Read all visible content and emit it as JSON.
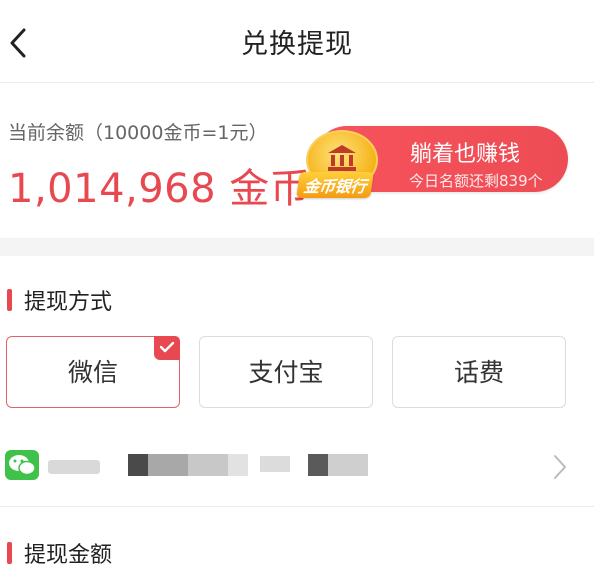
{
  "nav": {
    "title": "兑换提现"
  },
  "balance": {
    "label": "当前余额（10000金币=1元）",
    "value": "1,014,968 金币"
  },
  "gold_bank": {
    "badge": "金币银行",
    "headline": "躺着也赚钱",
    "subline": "今日名额还剩839个"
  },
  "withdraw_method": {
    "title": "提现方式",
    "options": [
      "微信",
      "支付宝",
      "话费"
    ],
    "selected": "微信"
  },
  "account": {
    "masked_text": ""
  },
  "withdraw_amount": {
    "title": "提现金额"
  },
  "colors": {
    "accent": "#e8484f",
    "wechat": "#3fc14a"
  }
}
